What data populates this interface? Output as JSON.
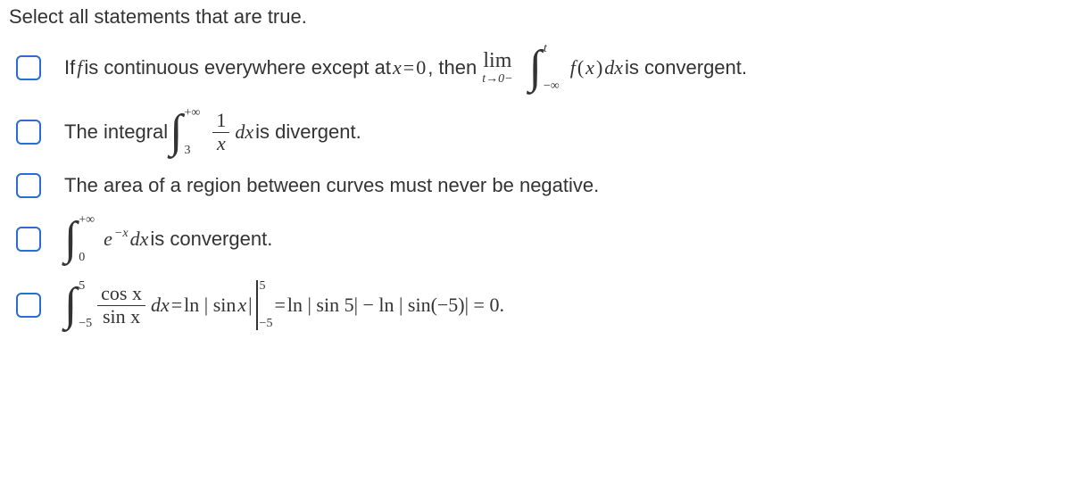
{
  "prompt": "Select all statements that are true.",
  "statements": {
    "s1": {
      "t_pre": "If ",
      "f": "f",
      "t_mid1": " is continuous everywhere except at ",
      "xeq": "x",
      "eq": " = ",
      "zero": "0",
      "t_then": ", then ",
      "lim": "lim",
      "lim_sub": "t→0−",
      "int_up": "t",
      "int_lo": "−∞",
      "fx": "f",
      "paren_o": "(",
      "x2": "x",
      "paren_c": ")",
      "dx": "dx",
      "t_post": " is convergent."
    },
    "s2": {
      "t_pre": "The integral ",
      "int_up": "+∞",
      "int_lo": "3",
      "num": "1",
      "den": "x",
      "dx": "dx",
      "t_post": " is divergent."
    },
    "s3": {
      "text": "The area of a region between curves must never be negative."
    },
    "s4": {
      "int_up": "+∞",
      "int_lo": "0",
      "e": "e",
      "exp": "−x",
      "dx": "dx",
      "t_post": " is convergent."
    },
    "s5": {
      "int_up": "5",
      "int_lo": "−5",
      "num": "cos x",
      "den": "sin x",
      "dx": "dx",
      "eq1": " = ",
      "ln1": "ln | sin ",
      "x": "x",
      "closeabs": "|",
      "bar_up": "5",
      "bar_lo": "−5",
      "eq2": " = ",
      "rhs": "ln | sin 5| − ln | sin(−5)| = 0."
    }
  }
}
